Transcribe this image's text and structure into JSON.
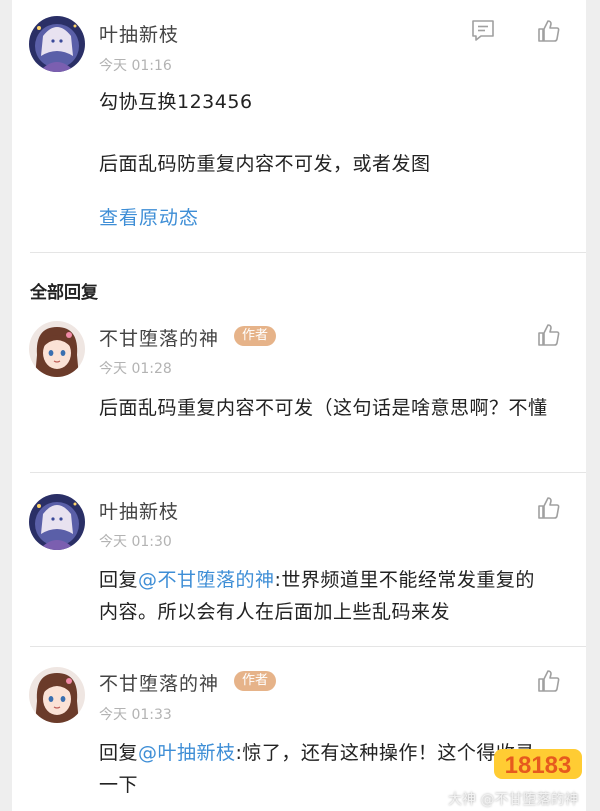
{
  "main_post": {
    "author": "叶抽新枝",
    "time": "今天 01:16",
    "line1": "勾协互换123456",
    "line2": "后面乱码防重复内容不可发，或者发图",
    "view_original": "查看原动态"
  },
  "replies_header": "全部回复",
  "author_badge": "作者",
  "replies": [
    {
      "author": "不甘堕落的神",
      "time": "今天 01:28",
      "text": "后面乱码重复内容不可发（这句话是啥意思啊？不懂"
    },
    {
      "author": "叶抽新枝",
      "time": "今天 01:30",
      "prefix": "回复",
      "mention": "@不甘堕落的神",
      "text": ":世界频道里不能经常发重复的内容。所以会有人在后面加上些乱码来发"
    },
    {
      "author": "不甘堕落的神",
      "time": "今天 01:33",
      "prefix": "回复",
      "mention": "@叶抽新枝",
      "text": ":惊了，还有这种操作！这个得收录一下"
    }
  ],
  "watermark": "大神 @不甘堕落的神",
  "logo_text": "18183",
  "icons": [
    "comment-icon",
    "like-icon"
  ],
  "colors": {
    "link": "#3e8ed6",
    "badge": "#e6b389",
    "background": "#eeeeee"
  }
}
